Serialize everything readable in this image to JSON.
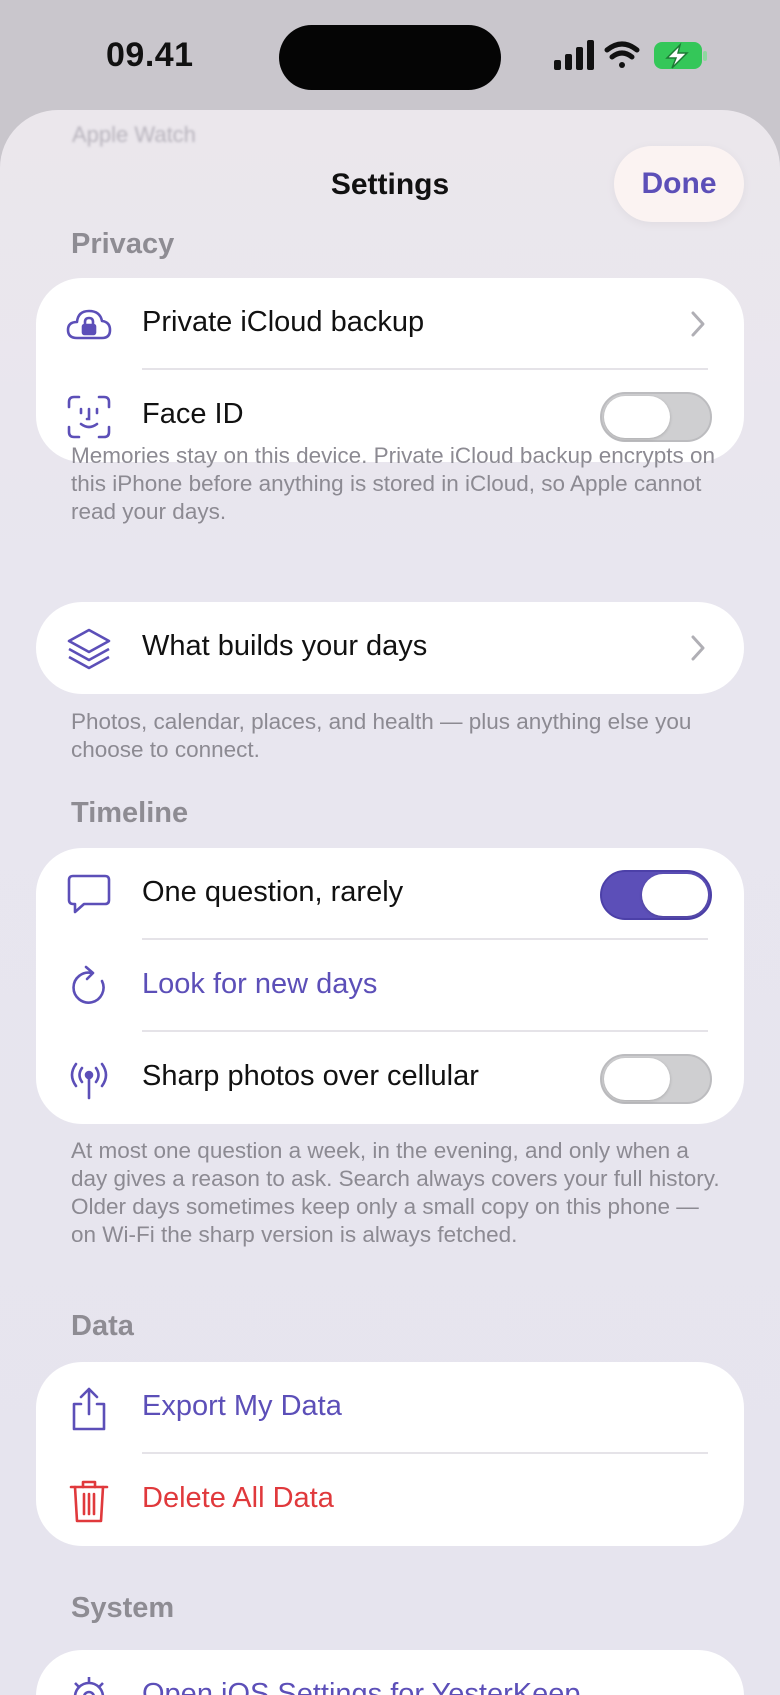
{
  "status_bar": {
    "time": "09.41"
  },
  "sheet": {
    "title": "Settings",
    "done_label": "Done",
    "ghost_text": "Apple Watch"
  },
  "privacy": {
    "header": "Privacy",
    "rows": [
      {
        "label": "Private iCloud backup",
        "icon": "lock-cloud-icon",
        "control": "chevron"
      },
      {
        "label": "Face ID",
        "icon": "face-id-icon",
        "control": "toggle",
        "on": false
      }
    ],
    "footnote": "Memories stay on this device. Private iCloud backup encrypts on this iPhone before anything is stored in iCloud, so Apple cannot read your days."
  },
  "sources": {
    "rows": [
      {
        "label": "What builds your days",
        "icon": "layers-icon",
        "control": "chevron"
      }
    ],
    "footnote": "Photos, calendar, places, and health — plus anything else you choose to connect."
  },
  "timeline": {
    "header": "Timeline",
    "rows": [
      {
        "label": "One question, rarely",
        "icon": "speech-bubble-icon",
        "control": "toggle",
        "on": true
      },
      {
        "label": "Look for new days",
        "icon": "refresh-icon",
        "control": "action"
      },
      {
        "label": "Sharp photos over cellular",
        "icon": "antenna-icon",
        "control": "toggle",
        "on": false
      }
    ],
    "footnote": "At most one question a week, in the evening, and only when a day gives a reason to ask. Search always covers your full history. Older days sometimes keep only a small copy on this phone — on Wi-Fi the sharp version is always fetched."
  },
  "data_section": {
    "header": "Data",
    "rows": [
      {
        "label": "Export My Data",
        "icon": "share-icon",
        "control": "action"
      },
      {
        "label": "Delete All Data",
        "icon": "trash-icon",
        "control": "destructive"
      }
    ]
  },
  "system": {
    "header": "System",
    "rows": [
      {
        "label": "Open iOS Settings for YesterKeep",
        "icon": "gear-icon",
        "control": "action"
      }
    ]
  },
  "colors": {
    "accent": "#5c4fb8",
    "danger": "#e0393c",
    "battery": "#34c759"
  }
}
